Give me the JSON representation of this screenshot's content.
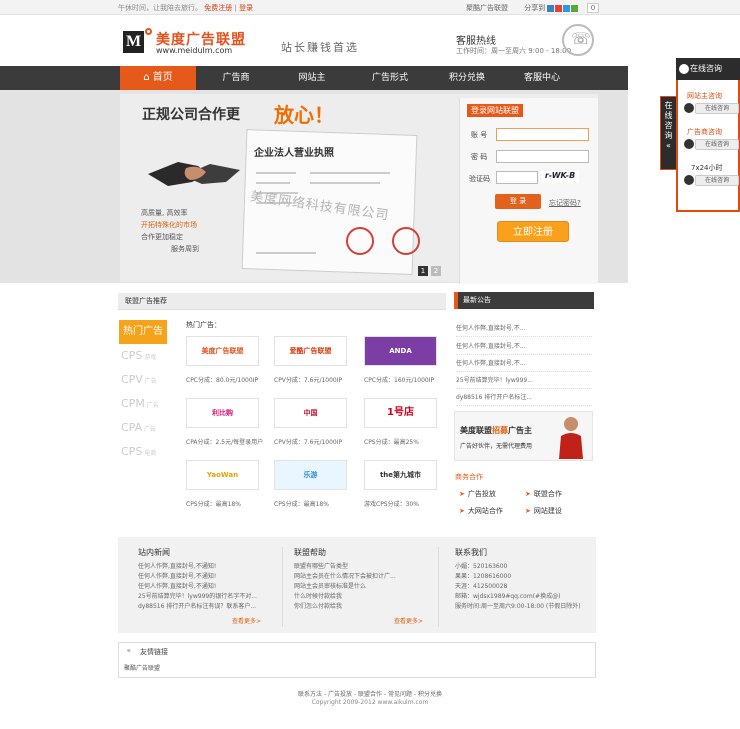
{
  "topbar": {
    "welcome": "午休时间，让我陪去旅行。",
    "register": "免费注册",
    "sep": "|",
    "login": "登录",
    "right_brand": "聚酷广告联盟",
    "share": "分享到",
    "share_count": "0"
  },
  "header": {
    "logo_mark": "M",
    "logo_cn": "美度广告联盟",
    "logo_en": "www.meidulm.com",
    "slogan": "站长赚钱首选",
    "hotline_title": "客服热线",
    "hotline_time": "工作时间：周一至周六 9:00 - 18:00"
  },
  "nav": [
    "首页",
    "广告商",
    "网站主",
    "广告形式",
    "积分兑换",
    "客服中心"
  ],
  "banner": {
    "title_part1": "正规公司合作更",
    "title_part2": "放心！",
    "lines": [
      "高质量, 高效率",
      "开拓特殊化的市场",
      "合作更加稳定",
      "服务周到"
    ],
    "license_title": "企业法人营业执照",
    "watermark": "美度网络科技有限公司",
    "pages": [
      "1",
      "2"
    ]
  },
  "login": {
    "title": "登录网站联盟",
    "account_label": "账    号",
    "password_label": "密    码",
    "captcha_label": "验证码",
    "captcha_text": "r-WK-B",
    "login_btn": "登 录",
    "forgot": "忘记密码?",
    "register_btn": "立即注册"
  },
  "consult": {
    "head": "在线咨询",
    "tab": "在线咨询",
    "items": [
      {
        "label": "网站主咨询",
        "btn": "在线咨询"
      },
      {
        "label": "广告商咨询",
        "btn": "在线咨询"
      },
      {
        "label": "7x24小时",
        "btn": "在线咨询"
      }
    ]
  },
  "recommend": {
    "head": "联盟广告推荐",
    "hot_label": "热门广告：",
    "tabs": [
      "热门广告",
      "CPS游戏",
      "CPV广告",
      "CPM广告",
      "CPA广告",
      "CPS电商"
    ],
    "ads": [
      {
        "name": "美度广告联盟",
        "caption": "CPC分成：80.0元/1000IP",
        "color": "#e5541e"
      },
      {
        "name": "爱酷广告联盟",
        "caption": "CPV分成：7.6元/1000IP",
        "color": "#d43b0c"
      },
      {
        "name": "ANDA",
        "caption": "CPC分成：160元/1000IP",
        "color": "#7c3ea5"
      },
      {
        "name": "利比购 LBG123.COM",
        "caption": "CPA分成：2.5元/每登录用户",
        "color": "#d4147a"
      },
      {
        "name": "中国",
        "caption": "CPV分成：7.6元/1000IP",
        "color": "#c8102e"
      },
      {
        "name": "1号店",
        "caption": "CPS分成：最高25%",
        "color": "#d2001e"
      },
      {
        "name": "YaoWan",
        "caption": "CPS分成：最高18%",
        "color": "#e8a200"
      },
      {
        "name": "乐游",
        "caption": "CPS分成：最高18%",
        "color": "#2a8fd0"
      },
      {
        "name": "the第九城市",
        "caption": "游戏CPS分成：30%",
        "color": "#333333"
      }
    ]
  },
  "news": {
    "head": "最新公告",
    "items": [
      "任何人作弊,直接封号,不...",
      "任何人作弊,直接封号,不...",
      "任何人作弊,直接封号,不...",
      "25号前结算完毕！lyw999...",
      "dy88516 排行开户名标注..."
    ],
    "promo_title_a": "美度联盟",
    "promo_title_b": "招募",
    "promo_title_c": "广告主",
    "promo_sub": "广告好伙伴，无需代理费用"
  },
  "business": {
    "head": "商务合作",
    "items": [
      "广告投放",
      "联盟合作",
      "大网站合作",
      "网站建设"
    ]
  },
  "info": {
    "col1_head": "站内新闻",
    "col1": [
      "任何人作弊,直接封号,不通知!",
      "任何人作弊,直接封号,不通知!",
      "任何人作弊,直接封号,不通知!",
      "25号前结算完毕！lyw999的银行名字不对...",
      "dy88516 排行开户名标注有误？联系客户..."
    ],
    "col2_head": "联盟帮助",
    "col2": [
      "联盟有哪些广告类型",
      "网站主会员在什么情况下会被扣计广...",
      "网站主会员审核标准是什么",
      "什么时候付款给我",
      "你们怎么付款给我"
    ],
    "col3_head": "联系我们",
    "col3": [
      "小媚：520163600",
      "果果：1208616000",
      "天涯：412500028",
      "邮箱：wjdsx1989#qq.com(#换成@)",
      "服务时间:周一至周六9:00-18:00 (节假日除外)"
    ],
    "more": "查看更多>"
  },
  "links": {
    "head": "友情链接",
    "value": "聚酷广告联盟"
  },
  "footer": {
    "line1": "联系方法 - 广告投放 - 联盟合作 - 常见问题 - 积分兑换",
    "line2": "Copyright 2009-2012 www.aikulm.com"
  }
}
